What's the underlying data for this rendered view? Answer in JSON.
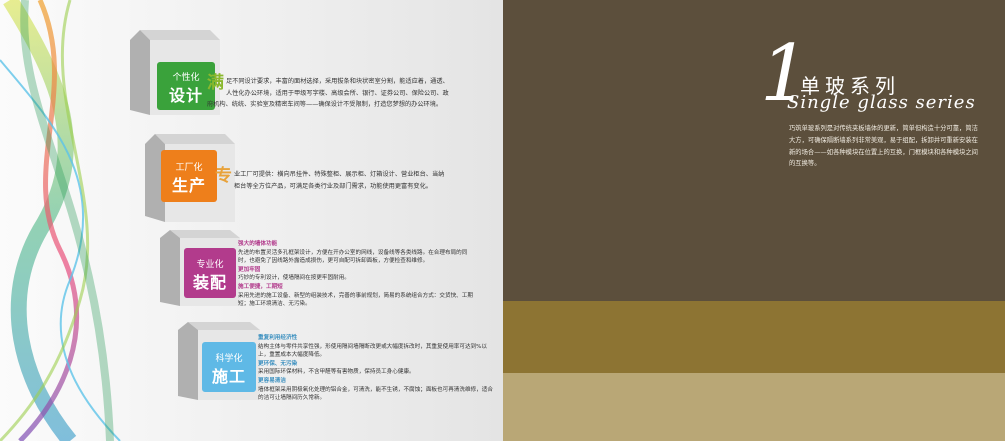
{
  "right": {
    "number": "1",
    "title_zh": "单玻系列",
    "title_en": "Single glass series",
    "description": "巧筑单玻系列是对传统夹板墙体的更新，简单但构造十分可靠，简洁大方，可确保隔断墙系列非常美观，易于组配，拆卸并可重新安装在新的场合——如各种模块在位置上的互换，门框模块和各种模块之间的互换等。"
  },
  "blocks": [
    {
      "small": "个性化",
      "large": "设计",
      "color": "#3aa23b",
      "big_char": "满",
      "text": "足不同设计要求，丰富的面材选择，采用拔条和块状密室分割，能适应着，通透、人性化办公环境，适用于甲级写字楼、高级会所、银行、证券公司、保险公司、政府机构、统统、实验室及精密车间等——确保设计不受限制，打造您梦想的办公环境。"
    },
    {
      "small": "工厂化",
      "large": "生产",
      "color": "#ee7f1b",
      "big_char": "专",
      "text": "业工厂可提供：横向吊挂件、特殊整柜、展示柜、灯箱设计、营业柜台、当纳柜台等全方位产品，可满足各类行业及部门需求，功能使用更富有变化。"
    },
    {
      "small": "专业化",
      "large": "装配",
      "color": "#b23b8c",
      "sections": [
        {
          "heading": "强大的墙体功能",
          "text": "先进的布置灵活多孔框架设计，方便在开办公室的网线，设备线等各类线路。在合理布局的同时，也避免了因线路外露造成损伤，更可自配可拆卸面板，方便检查和维修。"
        },
        {
          "heading": "更加牢固",
          "text": "巧妙的专利设计，使墙隔间在按更牢固耐用。"
        },
        {
          "heading": "施工便捷，工期短",
          "text": "采用先进的施工设备、新型的组装技术，完善的事前规划，简易的系统组合方式：交货快、工期短；施工环境清洁、无污染。"
        }
      ]
    },
    {
      "small": "科学化",
      "large": "施工",
      "color": "#5fb9e6",
      "sections": [
        {
          "heading": "重复利用经济性",
          "text": "结构主体与零件共享性强，形使用隔间墙隔断改更或大幅度拆改时，其重复使用率可达到%以上，重置成本大幅度降低。"
        },
        {
          "heading": "更环保、无污染",
          "text": "采用国际环保材料，不含甲醛等有害物质，保持员工身心健康。"
        },
        {
          "heading": "更容易清洁",
          "text": "墙体框架采用阴极氧化处理的铝合金，可清洗，能不生锈，不腐蚀；面板也可再清洗维修，适合的洁可让墙隔间历久常新。"
        }
      ]
    }
  ]
}
